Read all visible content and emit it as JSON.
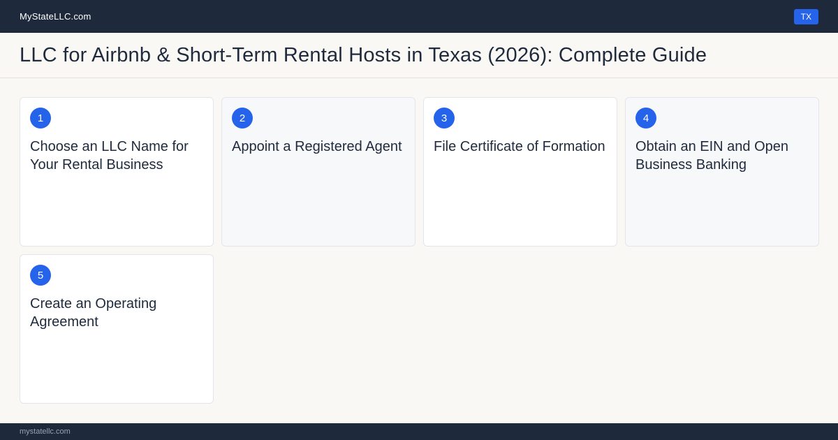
{
  "header": {
    "brand": "MyStateLLC.com",
    "state_badge": "TX"
  },
  "page": {
    "title": "LLC for Airbnb & Short-Term Rental Hosts in Texas (2026): Complete Guide"
  },
  "steps": [
    {
      "number": "1",
      "title": "Choose an LLC Name for Your Rental Business"
    },
    {
      "number": "2",
      "title": "Appoint a Registered Agent"
    },
    {
      "number": "3",
      "title": "File Certificate of Formation"
    },
    {
      "number": "4",
      "title": "Obtain an EIN and Open Business Banking"
    },
    {
      "number": "5",
      "title": "Create an Operating Agreement"
    }
  ],
  "footer": {
    "domain": "mystatellc.com"
  },
  "colors": {
    "header_bg": "#1e293b",
    "accent": "#2563eb",
    "page_bg": "#faf8f4"
  }
}
